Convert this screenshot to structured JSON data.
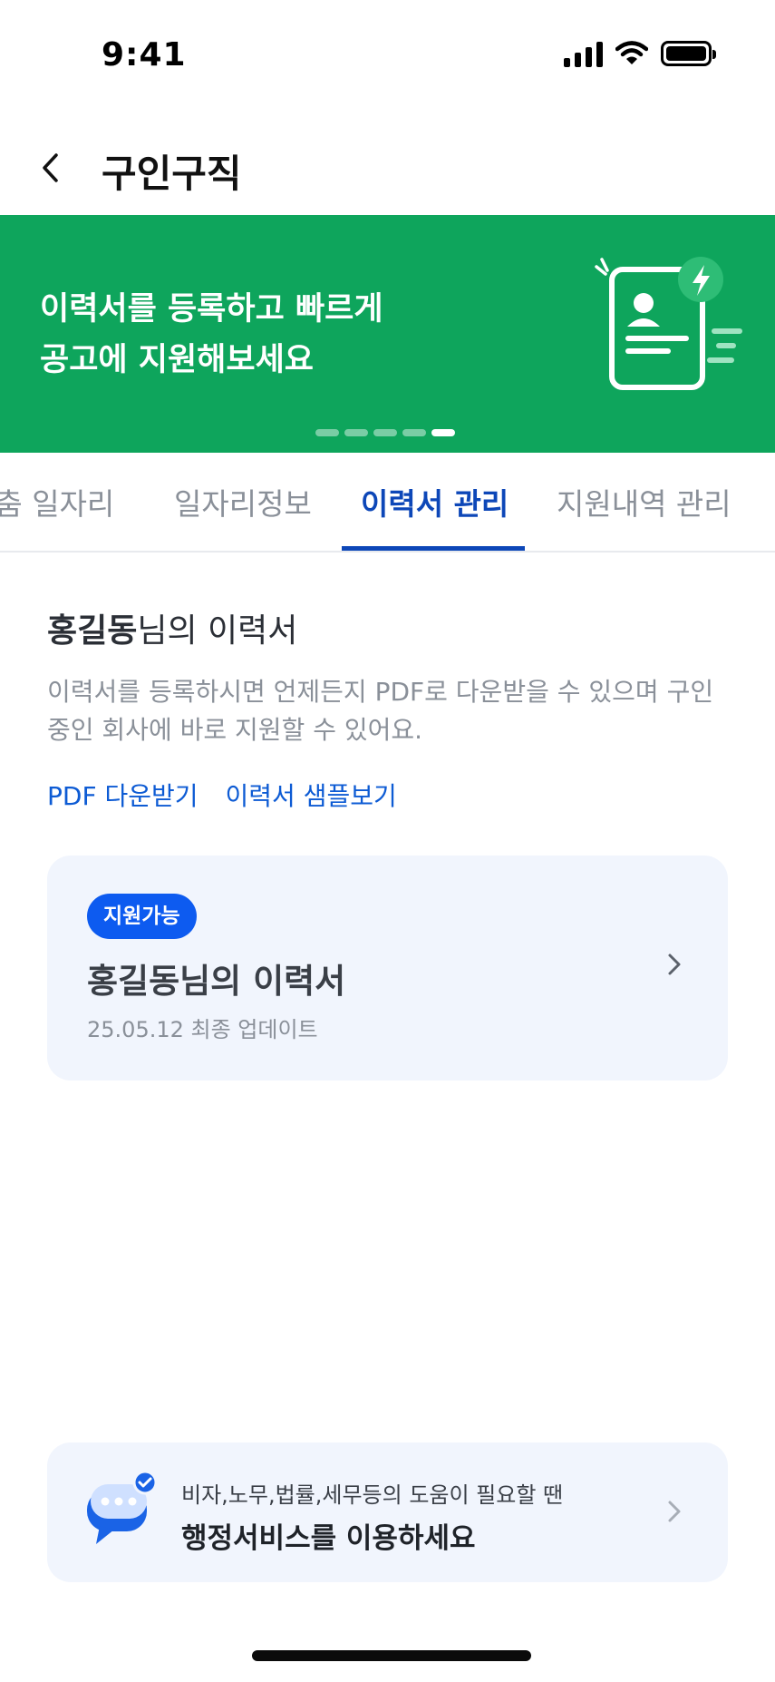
{
  "status_bar": {
    "time": "9:41"
  },
  "header": {
    "title": "구인구직"
  },
  "banner": {
    "line1": "이력서를 등록하고 빠르게",
    "line2": "공고에 지원해보세요",
    "page_count": 5,
    "active_page": 5
  },
  "tabs": [
    {
      "label": "맞춤 일자리",
      "active": false
    },
    {
      "label": "일자리정보",
      "active": false
    },
    {
      "label": "이력서 관리",
      "active": true
    },
    {
      "label": "지원내역 관리",
      "active": false
    }
  ],
  "resume": {
    "heading_name": "홍길동",
    "heading_suffix": "님의 이력서",
    "description": "이력서를 등록하시면 언제든지 PDF로 다운받을 수 있으며 구인중인 회사에 바로 지원할 수 있어요.",
    "links": {
      "pdf_download": "PDF 다운받기",
      "sample": "이력서 샘플보기"
    },
    "card": {
      "badge": "지원가능",
      "title": "홍길동님의 이력서",
      "updated": "25.05.12 최종 업데이트"
    }
  },
  "service": {
    "small_text": "비자,노무,법률,세무등의 도움이 필요할 땐",
    "big_text": "행정서비스를 이용하세요"
  },
  "colors": {
    "banner_bg": "#0ea55c",
    "accent_blue": "#0d47b8",
    "badge_blue": "#0d5bf0",
    "card_bg": "#f1f5fd"
  }
}
